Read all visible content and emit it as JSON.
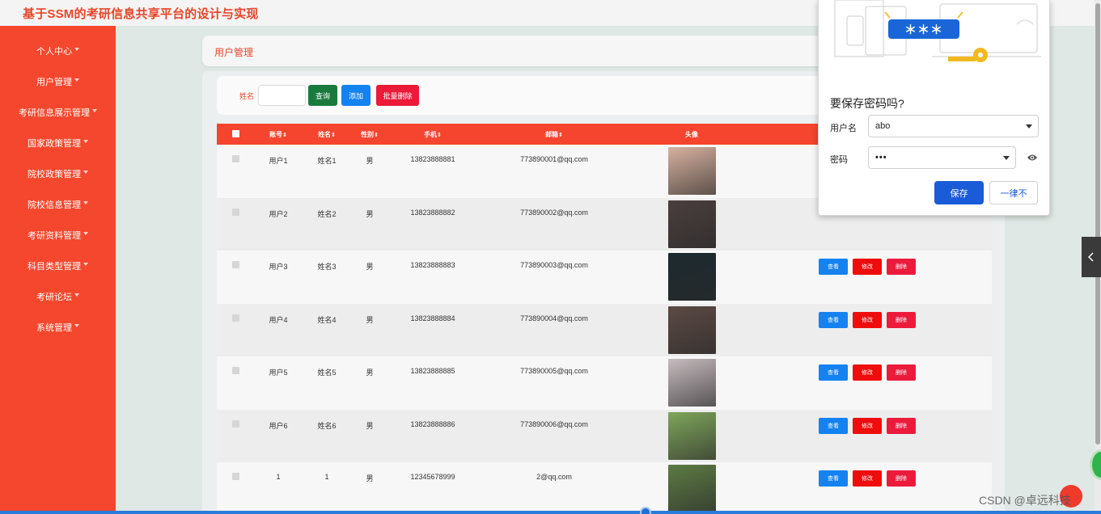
{
  "app": {
    "title": "基于SSM的考研信息共享平台的设计与实现"
  },
  "sidebar": {
    "items": [
      {
        "label": "个人中心"
      },
      {
        "label": "用户管理"
      },
      {
        "label": "考研信息展示管理"
      },
      {
        "label": "国家政策管理"
      },
      {
        "label": "院校政策管理"
      },
      {
        "label": "院校信息管理"
      },
      {
        "label": "考研资料管理"
      },
      {
        "label": "科目类型管理"
      },
      {
        "label": "考研论坛"
      },
      {
        "label": "系统管理"
      }
    ]
  },
  "breadcrumb": {
    "current": "用户管理"
  },
  "search": {
    "label": "姓名",
    "value": "",
    "query_label": "查询",
    "add_label": "添加",
    "bulk_delete_label": "批量删除"
  },
  "table": {
    "columns": [
      "账号",
      "姓名",
      "性别",
      "手机",
      "邮箱",
      "头像"
    ],
    "sort_marker": "⇕",
    "rows": [
      {
        "account": "用户1",
        "name": "姓名1",
        "sex": "男",
        "phone": "13823888881",
        "email": "773890001@qq.com",
        "avatar_color": "#d8b2a0"
      },
      {
        "account": "用户2",
        "name": "姓名2",
        "sex": "男",
        "phone": "13823888882",
        "email": "773890002@qq.com",
        "avatar_color": "#4a3f3d"
      },
      {
        "account": "用户3",
        "name": "姓名3",
        "sex": "男",
        "phone": "13823888883",
        "email": "773890003@qq.com",
        "avatar_color": "#1c2a2f"
      },
      {
        "account": "用户4",
        "name": "姓名4",
        "sex": "男",
        "phone": "13823888884",
        "email": "773890004@qq.com",
        "avatar_color": "#5c4a44"
      },
      {
        "account": "用户5",
        "name": "姓名5",
        "sex": "男",
        "phone": "13823888885",
        "email": "773890005@qq.com",
        "avatar_color": "#c7bcbf"
      },
      {
        "account": "用户6",
        "name": "姓名6",
        "sex": "男",
        "phone": "13823888886",
        "email": "773890006@qq.com",
        "avatar_color": "#7fa55a"
      },
      {
        "account": "1",
        "name": "1",
        "sex": "男",
        "phone": "12345678999",
        "email": "2@qq.com",
        "avatar_color": "#5d7b44"
      }
    ],
    "ops": {
      "view": "查看",
      "edit": "修改",
      "delete": "删除"
    }
  },
  "password_dialog": {
    "illus_mask": "＊＊＊",
    "title": "要保存密码吗?",
    "username_label": "用户名",
    "username_value": "abo",
    "password_label": "密码",
    "password_value": "•••",
    "save_label": "保存",
    "never_label": "一律不"
  },
  "watermark": "CSDN @卓远科技",
  "colors": {
    "accent": "#f5472d",
    "primary": "#1482f0",
    "danger": "#ee0c0c",
    "save": "#1a5bd8"
  }
}
